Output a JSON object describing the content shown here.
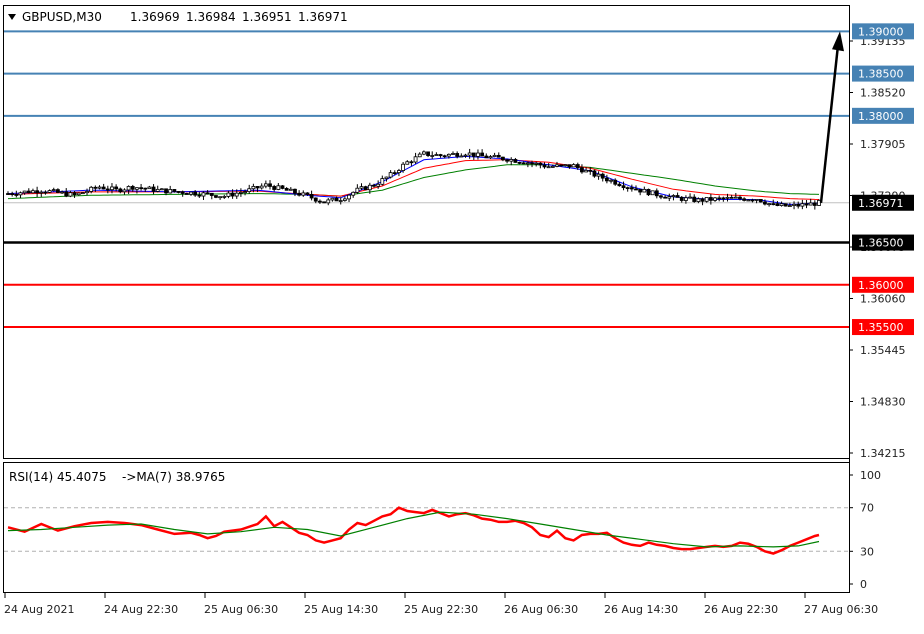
{
  "header": {
    "symbol": "GBPUSD,M30",
    "open": "1.36969",
    "high": "1.36984",
    "low": "1.36951",
    "close": "1.36971"
  },
  "rsi_header": {
    "label": "RSI(14) 45.4075",
    "ma_label": "->MA(7) 38.9765"
  },
  "colors": {
    "bull": "#000000",
    "bear": "#000000",
    "ma_fast": "#0000ff",
    "ma_mid": "#ff0000",
    "ma_slow": "#008000",
    "resistance": "#4682b4",
    "pivot": "#000000",
    "support": "#ff0000",
    "rsi": "#ff0000",
    "rsi_ma": "#008000",
    "arrow": "#000000"
  },
  "icons": {
    "collapse": "triangle-down-icon"
  },
  "chart_data": [
    {
      "type": "candlestick",
      "symbol": "GBPUSD",
      "timeframe": "M30",
      "ylim": [
        1.3395,
        1.393
      ],
      "ytick_labels": [
        "1.39135",
        "1.38520",
        "1.37905",
        "1.37290",
        "1.36675",
        "1.36060",
        "1.35445",
        "1.34830",
        "1.34215"
      ],
      "x_labels": [
        "24 Aug 2021",
        "24 Aug 22:30",
        "25 Aug 06:30",
        "25 Aug 14:30",
        "25 Aug 22:30",
        "26 Aug 06:30",
        "26 Aug 14:30",
        "26 Aug 22:30",
        "27 Aug 06:30"
      ],
      "current_price": {
        "value": 1.36971,
        "label": "1.36971"
      },
      "levels": [
        {
          "value": 1.39,
          "label": "1.39000",
          "role": "resistance"
        },
        {
          "value": 1.385,
          "label": "1.38500",
          "role": "resistance"
        },
        {
          "value": 1.38,
          "label": "1.38000",
          "role": "resistance"
        },
        {
          "value": 1.365,
          "label": "1.36500",
          "role": "pivot"
        },
        {
          "value": 1.36,
          "label": "1.36000",
          "role": "support"
        },
        {
          "value": 1.355,
          "label": "1.35500",
          "role": "support"
        }
      ],
      "arrow": {
        "from": 1.3697,
        "to": 1.3893,
        "direction": "up"
      },
      "close_path": [
        [
          0,
          1.3708
        ],
        [
          8,
          1.3712
        ],
        [
          16,
          1.3706
        ],
        [
          22,
          1.3716
        ],
        [
          26,
          1.3712
        ],
        [
          30,
          1.3716
        ],
        [
          36,
          1.3712
        ],
        [
          44,
          1.3709
        ],
        [
          52,
          1.3705
        ],
        [
          58,
          1.3712
        ],
        [
          62,
          1.3718
        ],
        [
          66,
          1.3713
        ],
        [
          72,
          1.3705
        ],
        [
          76,
          1.3698
        ],
        [
          80,
          1.3702
        ],
        [
          84,
          1.3712
        ],
        [
          88,
          1.3718
        ],
        [
          92,
          1.373
        ],
        [
          96,
          1.3745
        ],
        [
          100,
          1.3755
        ],
        [
          104,
          1.3753
        ],
        [
          110,
          1.3756
        ],
        [
          114,
          1.3752
        ],
        [
          120,
          1.3749
        ],
        [
          126,
          1.3744
        ],
        [
          130,
          1.374
        ],
        [
          136,
          1.3741
        ],
        [
          140,
          1.3732
        ],
        [
          144,
          1.3725
        ],
        [
          148,
          1.3718
        ],
        [
          152,
          1.3712
        ],
        [
          156,
          1.3707
        ],
        [
          160,
          1.3703
        ],
        [
          166,
          1.37
        ],
        [
          172,
          1.3702
        ],
        [
          180,
          1.3702
        ],
        [
          184,
          1.3694
        ],
        [
          188,
          1.3693
        ],
        [
          192,
          1.3695
        ],
        [
          195,
          1.3697
        ]
      ],
      "ma_fast_path": [
        [
          0,
          1.3708
        ],
        [
          20,
          1.3712
        ],
        [
          40,
          1.371
        ],
        [
          60,
          1.3712
        ],
        [
          72,
          1.3706
        ],
        [
          80,
          1.3703
        ],
        [
          90,
          1.3722
        ],
        [
          100,
          1.3748
        ],
        [
          110,
          1.3752
        ],
        [
          120,
          1.3749
        ],
        [
          130,
          1.3742
        ],
        [
          140,
          1.3735
        ],
        [
          150,
          1.3716
        ],
        [
          160,
          1.3704
        ],
        [
          170,
          1.3701
        ],
        [
          180,
          1.3701
        ],
        [
          188,
          1.3695
        ],
        [
          195,
          1.3697
        ]
      ],
      "ma_mid_path": [
        [
          0,
          1.3707
        ],
        [
          20,
          1.371
        ],
        [
          40,
          1.371
        ],
        [
          60,
          1.3711
        ],
        [
          72,
          1.3707
        ],
        [
          80,
          1.3705
        ],
        [
          90,
          1.3717
        ],
        [
          100,
          1.3738
        ],
        [
          110,
          1.3747
        ],
        [
          120,
          1.3748
        ],
        [
          130,
          1.3745
        ],
        [
          140,
          1.3738
        ],
        [
          150,
          1.3725
        ],
        [
          160,
          1.3713
        ],
        [
          170,
          1.3707
        ],
        [
          180,
          1.3705
        ],
        [
          188,
          1.3702
        ],
        [
          195,
          1.3701
        ]
      ],
      "ma_slow_path": [
        [
          0,
          1.3702
        ],
        [
          20,
          1.3706
        ],
        [
          40,
          1.3707
        ],
        [
          60,
          1.3708
        ],
        [
          72,
          1.3707
        ],
        [
          80,
          1.3705
        ],
        [
          90,
          1.3712
        ],
        [
          100,
          1.3727
        ],
        [
          110,
          1.3736
        ],
        [
          120,
          1.3742
        ],
        [
          130,
          1.3742
        ],
        [
          140,
          1.3739
        ],
        [
          150,
          1.3732
        ],
        [
          160,
          1.3725
        ],
        [
          170,
          1.3717
        ],
        [
          180,
          1.3711
        ],
        [
          188,
          1.3708
        ],
        [
          195,
          1.3707
        ]
      ]
    },
    {
      "type": "line",
      "title": "RSI(14) 45.4075",
      "ylim": [
        0,
        100
      ],
      "ytick_labels": [
        "100",
        "70",
        "30",
        "0"
      ],
      "levels": [
        70,
        30
      ],
      "series": [
        {
          "name": "RSI(14)",
          "points": [
            [
              0,
              52
            ],
            [
              4,
              48
            ],
            [
              8,
              55
            ],
            [
              12,
              49
            ],
            [
              16,
              53
            ],
            [
              20,
              56
            ],
            [
              24,
              57
            ],
            [
              28,
              56
            ],
            [
              32,
              54
            ],
            [
              36,
              50
            ],
            [
              40,
              46
            ],
            [
              44,
              47
            ],
            [
              46,
              45
            ],
            [
              48,
              42
            ],
            [
              50,
              44
            ],
            [
              52,
              48
            ],
            [
              56,
              50
            ],
            [
              60,
              55
            ],
            [
              62,
              62
            ],
            [
              64,
              53
            ],
            [
              66,
              57
            ],
            [
              68,
              52
            ],
            [
              70,
              47
            ],
            [
              72,
              45
            ],
            [
              74,
              40
            ],
            [
              76,
              38
            ],
            [
              78,
              40
            ],
            [
              80,
              42
            ],
            [
              82,
              50
            ],
            [
              84,
              56
            ],
            [
              86,
              54
            ],
            [
              88,
              58
            ],
            [
              90,
              62
            ],
            [
              92,
              64
            ],
            [
              94,
              70
            ],
            [
              96,
              67
            ],
            [
              98,
              66
            ],
            [
              100,
              65
            ],
            [
              102,
              68
            ],
            [
              104,
              65
            ],
            [
              106,
              62
            ],
            [
              108,
              64
            ],
            [
              110,
              65
            ],
            [
              112,
              63
            ],
            [
              114,
              60
            ],
            [
              116,
              59
            ],
            [
              118,
              57
            ],
            [
              120,
              57
            ],
            [
              122,
              58
            ],
            [
              124,
              56
            ],
            [
              126,
              52
            ],
            [
              128,
              45
            ],
            [
              130,
              43
            ],
            [
              132,
              49
            ],
            [
              134,
              42
            ],
            [
              136,
              40
            ],
            [
              138,
              45
            ],
            [
              140,
              46
            ],
            [
              142,
              46
            ],
            [
              144,
              47
            ],
            [
              146,
              42
            ],
            [
              148,
              38
            ],
            [
              150,
              36
            ],
            [
              152,
              35
            ],
            [
              154,
              38
            ],
            [
              156,
              36
            ],
            [
              158,
              35
            ],
            [
              160,
              33
            ],
            [
              162,
              32
            ],
            [
              164,
              32
            ],
            [
              166,
              33
            ],
            [
              168,
              34
            ],
            [
              170,
              35
            ],
            [
              172,
              34
            ],
            [
              174,
              35
            ],
            [
              176,
              38
            ],
            [
              178,
              37
            ],
            [
              180,
              34
            ],
            [
              182,
              30
            ],
            [
              184,
              28
            ],
            [
              186,
              31
            ],
            [
              188,
              35
            ],
            [
              190,
              38
            ],
            [
              192,
              41
            ],
            [
              194,
              44
            ],
            [
              195,
              45
            ]
          ]
        },
        {
          "name": "MA(7)",
          "points": [
            [
              0,
              49
            ],
            [
              8,
              50
            ],
            [
              16,
              52
            ],
            [
              24,
              54
            ],
            [
              32,
              55
            ],
            [
              40,
              50
            ],
            [
              48,
              46
            ],
            [
              56,
              48
            ],
            [
              64,
              52
            ],
            [
              72,
              50
            ],
            [
              80,
              44
            ],
            [
              88,
              52
            ],
            [
              96,
              60
            ],
            [
              104,
              66
            ],
            [
              112,
              64
            ],
            [
              120,
              60
            ],
            [
              128,
              55
            ],
            [
              136,
              50
            ],
            [
              144,
              45
            ],
            [
              152,
              41
            ],
            [
              160,
              37
            ],
            [
              168,
              34
            ],
            [
              176,
              35
            ],
            [
              184,
              34
            ],
            [
              190,
              35
            ],
            [
              195,
              39
            ]
          ]
        }
      ]
    }
  ]
}
